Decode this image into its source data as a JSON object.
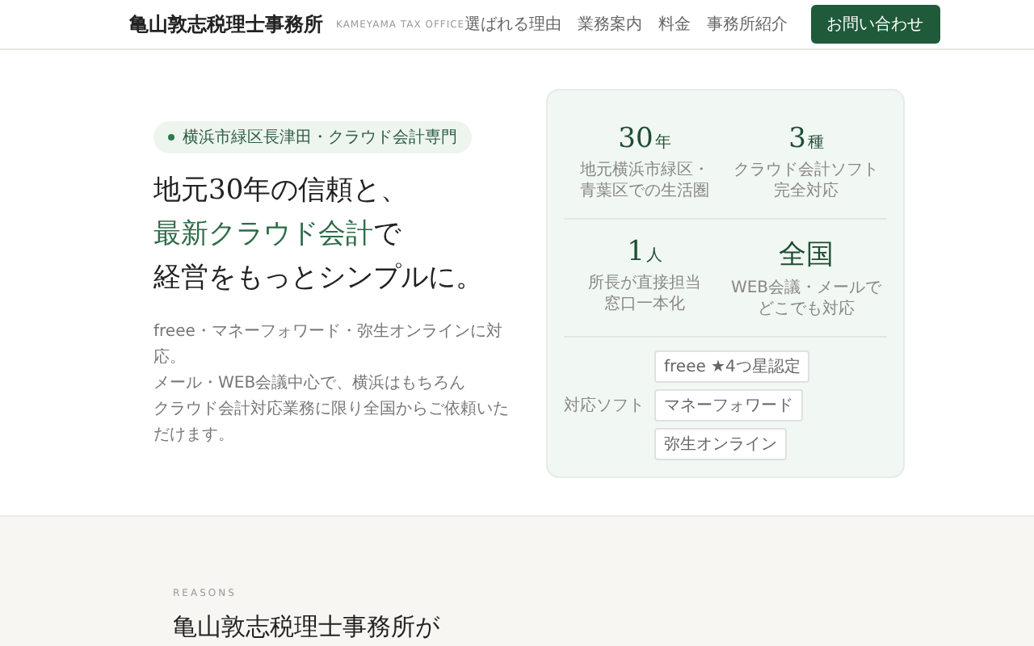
{
  "header": {
    "logo": "亀山敦志税理士事務所",
    "logo_sub": "KAMEYAMA TAX OFFICE",
    "nav": [
      "選ばれる理由",
      "業務案内",
      "料金",
      "事務所紹介"
    ],
    "cta": "お問い合わせ"
  },
  "hero": {
    "badge": "横浜市緑区長津田・クラウド会計専門",
    "heading": [
      [
        {
          "text": "地元30年の信頼と、",
          "accent": false
        }
      ],
      [
        {
          "text": "最新クラウド会計",
          "accent": true
        },
        {
          "text": "で",
          "accent": false
        }
      ],
      [
        {
          "text": "経営をもっとシンプルに。",
          "accent": false
        }
      ]
    ],
    "lead": [
      "freee・マネーフォワード・弥生オンラインに対応。",
      "メール・WEB会議中心で、横浜はもちろん",
      "クラウド会計対応業務に限り全国からご依頼いただけます。"
    ]
  },
  "stats_card": {
    "stats": [
      {
        "value": "30",
        "unit": "年",
        "lines": [
          "地元横浜市緑区・",
          "青葉区での生活圏"
        ]
      },
      {
        "value": "3",
        "unit": "種",
        "lines": [
          "クラウド会計ソフト",
          "完全対応"
        ]
      },
      {
        "value": "1",
        "unit": "人",
        "lines": [
          "所長が直接担当",
          "窓口一本化"
        ]
      },
      {
        "value": "全国",
        "lines": [
          "WEB会議・メールで",
          "どこでも対応"
        ]
      }
    ],
    "software_label": "対応ソフト",
    "software": [
      "freee ★4つ星認定",
      "マネーフォワード",
      "弥生オンライン"
    ]
  },
  "reasons": {
    "eyebrow": "REASONS",
    "heading": "亀山敦志税理士事務所が"
  }
}
